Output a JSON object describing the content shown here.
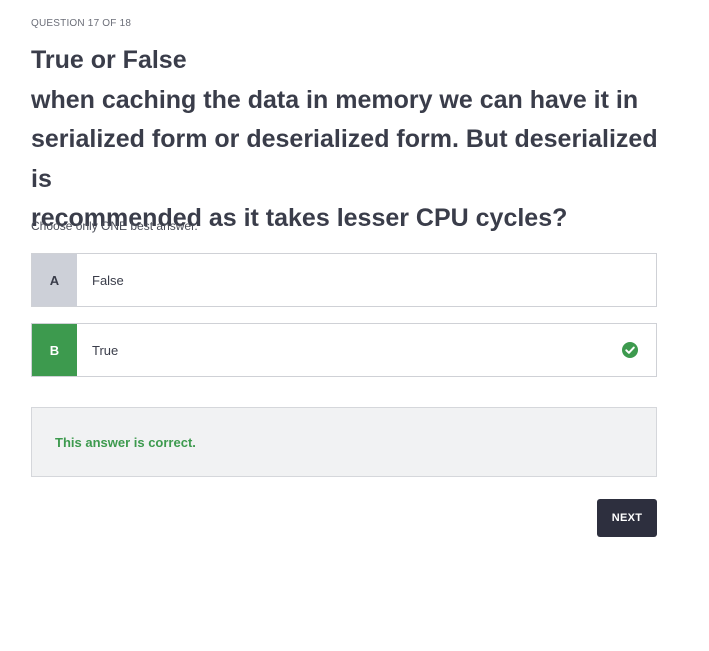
{
  "header": {
    "question_counter": "QUESTION 17 OF 18"
  },
  "question": {
    "line1": "True or False",
    "line2": "when caching the data in memory we can have it in",
    "line3": "serialized form or deserialized form. But deserialized is",
    "line4": "recommended as it takes lesser CPU cycles?"
  },
  "instructions": "Choose only ONE best answer.",
  "options": [
    {
      "letter": "A",
      "text": "False",
      "selected": false
    },
    {
      "letter": "B",
      "text": "True",
      "selected": true,
      "status_icon": "check-circle-icon"
    }
  ],
  "feedback": {
    "message": "This answer is correct."
  },
  "actions": {
    "next_label": "NEXT"
  },
  "colors": {
    "correct_green": "#3d9a4e",
    "button_dark": "#2d2f3e",
    "letter_gray": "#cdd0d8"
  }
}
